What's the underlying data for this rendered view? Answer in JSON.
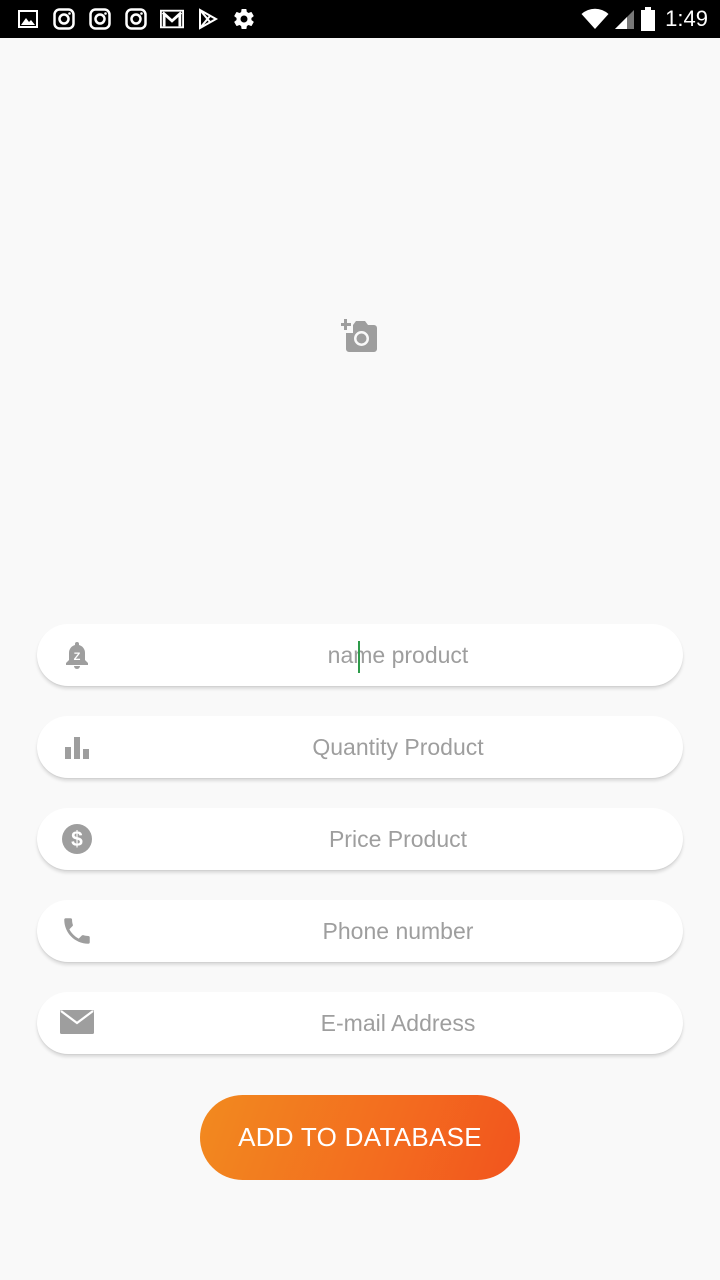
{
  "status_bar": {
    "time": "1:49",
    "left_icons": [
      "image-icon",
      "instagram-icon",
      "instagram-icon",
      "instagram-icon",
      "gmail-icon",
      "play-store-icon",
      "settings-icon"
    ],
    "right_icons": [
      "wifi-icon",
      "signal-icon",
      "battery-icon"
    ]
  },
  "image_picker": {
    "icon": "add-a-photo-icon"
  },
  "form": {
    "name": {
      "placeholder": "name product",
      "icon": "bell-z-icon"
    },
    "quantity": {
      "placeholder": "Quantity Product",
      "icon": "bar-chart-icon"
    },
    "price": {
      "placeholder": "Price Product",
      "icon": "dollar-icon"
    },
    "phone": {
      "placeholder": "Phone number",
      "icon": "phone-icon"
    },
    "email": {
      "placeholder": "E-mail Address",
      "icon": "mail-icon"
    }
  },
  "button": {
    "label": "ADD TO DATABASE"
  },
  "colors": {
    "accent_start": "#f28a1f",
    "accent_end": "#f2541e",
    "icon_gray": "#9e9e9e",
    "background": "#f9f9f9"
  }
}
